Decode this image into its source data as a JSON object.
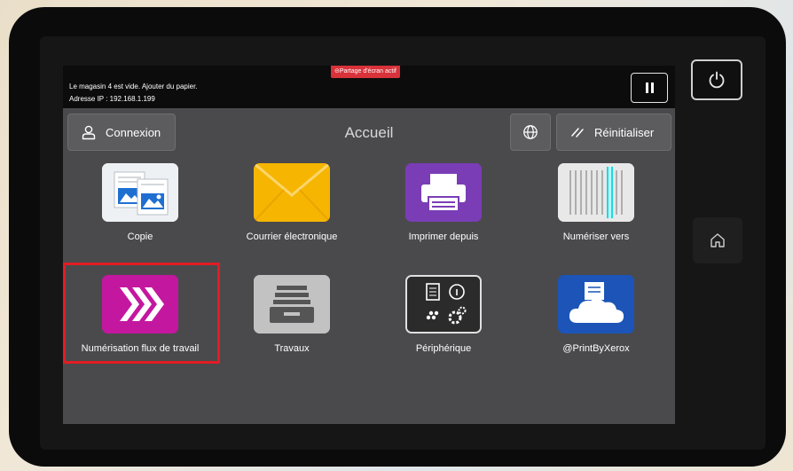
{
  "status": {
    "message": "Le magasin 4 est vide.  Ajouter du papier.",
    "ip": "Adresse IP : 192.168.1.199",
    "screen_share_badge": "⊝Partage d'écran actif"
  },
  "header": {
    "login_label": "Connexion",
    "title": "Accueil",
    "reset_label": "Réinitialiser"
  },
  "apps": [
    {
      "label": "Copie",
      "icon": "copy-icon"
    },
    {
      "label": "Courrier électronique",
      "icon": "envelope-icon"
    },
    {
      "label": "Imprimer depuis",
      "icon": "printer-icon"
    },
    {
      "label": "Numériser vers",
      "icon": "scan-icon"
    },
    {
      "label": "Numérisation flux de travail",
      "icon": "workflow-chevrons-icon",
      "selected": true
    },
    {
      "label": "Travaux",
      "icon": "jobs-tray-icon"
    },
    {
      "label": "Périphérique",
      "icon": "device-settings-icon"
    },
    {
      "label": "@PrintByXerox",
      "icon": "cloud-print-icon"
    }
  ],
  "colors": {
    "highlight_border": "#e21c24",
    "badge": "#d8323a",
    "screen_bg": "#4a4a4c"
  }
}
